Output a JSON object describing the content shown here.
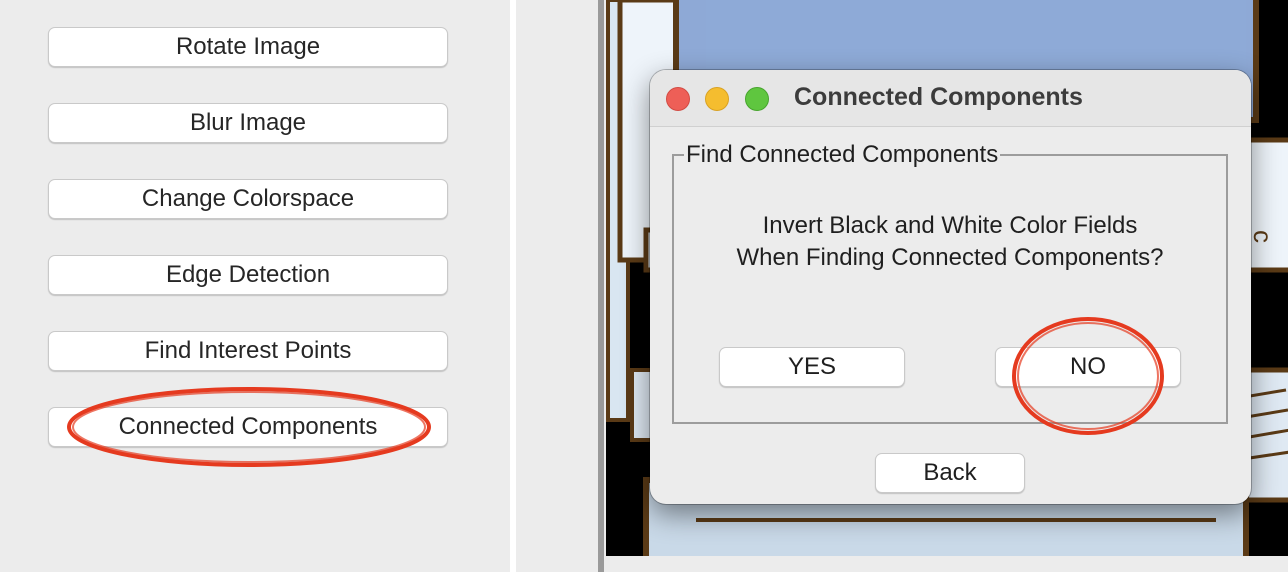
{
  "sidebar": {
    "buttons": [
      {
        "label": "Rotate Image"
      },
      {
        "label": "Blur Image"
      },
      {
        "label": "Change Colorspace"
      },
      {
        "label": "Edge Detection"
      },
      {
        "label": "Find Interest Points"
      },
      {
        "label": "Connected Components"
      }
    ]
  },
  "dialog": {
    "title": "Connected Components",
    "group_title": "Find Connected Components",
    "question_line1": "Invert Black and White Color Fields",
    "question_line2": "When Finding Connected Components?",
    "yes_label": "YES",
    "no_label": "NO",
    "back_label": "Back"
  },
  "colors": {
    "annotation": "#e53a1f",
    "traffic_red": "#ee5f57",
    "traffic_yellow": "#f5bd2f",
    "traffic_green": "#5fc63f"
  }
}
